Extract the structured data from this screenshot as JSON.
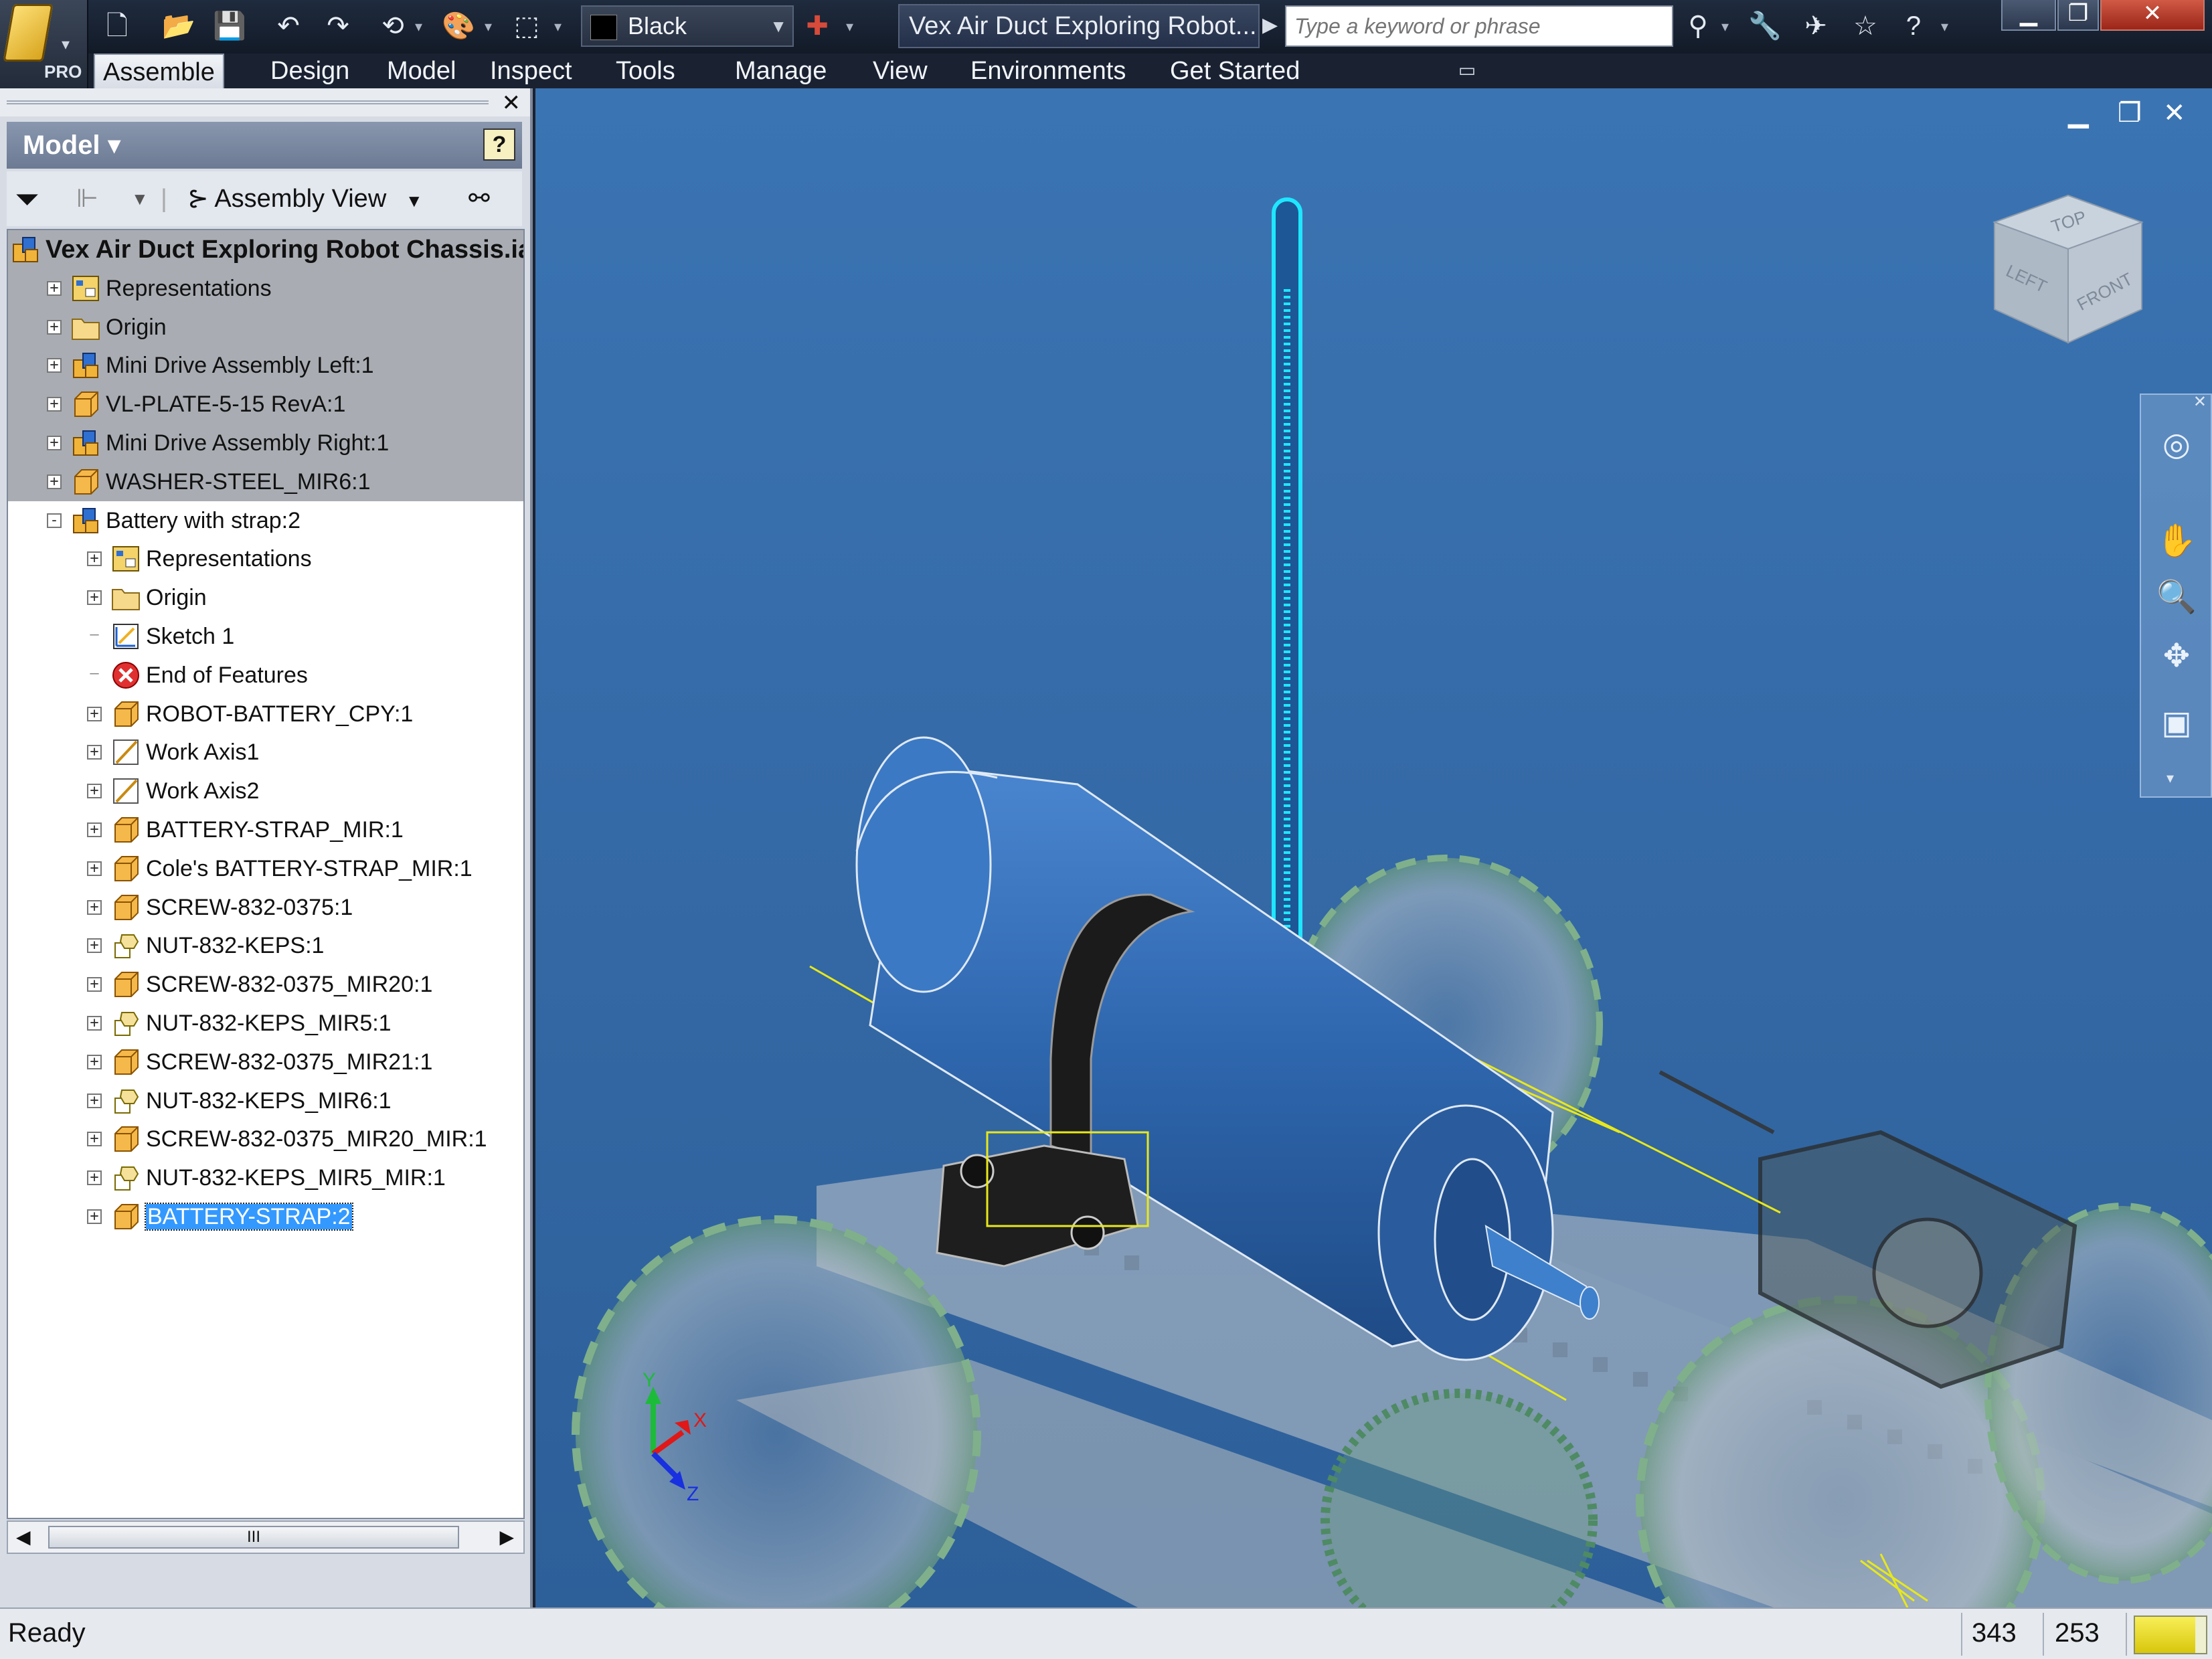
{
  "app": {
    "name": "Autodesk Inventor",
    "edition_badge": "PRO",
    "document_title": "Vex Air Duct Exploring Robot..."
  },
  "quick_access": {
    "icons": [
      "new-icon",
      "open-icon",
      "save-icon",
      "undo-icon",
      "redo-icon",
      "return-icon",
      "appearance-icon",
      "select-icon"
    ],
    "color_selector": {
      "value": "Black",
      "swatch": "#000000"
    }
  },
  "search": {
    "placeholder": "Type a keyword or phrase"
  },
  "help_icons": [
    "binoculars-icon",
    "wrench-icon",
    "satellite-icon",
    "star-icon",
    "help-icon"
  ],
  "ribbon": {
    "tabs": [
      "Assemble",
      "Design",
      "Model",
      "Inspect",
      "Tools",
      "Manage",
      "View",
      "Environments",
      "Get Started"
    ],
    "active_tab": "Assemble"
  },
  "browser": {
    "title": "Model",
    "view_label": "Assembly View",
    "help_glyph": "?",
    "tree": [
      {
        "label": "Vex Air Duct Exploring Robot Chassis.iam",
        "icon": "assembly",
        "level": 0,
        "expander": ""
      },
      {
        "label": "Representations",
        "icon": "representations",
        "level": 1,
        "expander": "+"
      },
      {
        "label": "Origin",
        "icon": "folder",
        "level": 1,
        "expander": "+"
      },
      {
        "label": "Mini Drive Assembly Left:1",
        "icon": "assembly",
        "level": 1,
        "expander": "+"
      },
      {
        "label": "VL-PLATE-5-15 RevA:1",
        "icon": "part",
        "level": 1,
        "expander": "+"
      },
      {
        "label": "Mini Drive Assembly Right:1",
        "icon": "assembly",
        "level": 1,
        "expander": "+"
      },
      {
        "label": "WASHER-STEEL_MIR6:1",
        "icon": "part",
        "level": 1,
        "expander": "+"
      },
      {
        "label": "Battery with strap:2",
        "icon": "assembly",
        "level": 1,
        "expander": "-"
      },
      {
        "label": "Representations",
        "icon": "representations",
        "level": 2,
        "expander": "+"
      },
      {
        "label": "Origin",
        "icon": "folder",
        "level": 2,
        "expander": "+"
      },
      {
        "label": "Sketch 1",
        "icon": "sketch",
        "level": 2,
        "expander": ""
      },
      {
        "label": "End of Features",
        "icon": "end",
        "level": 2,
        "expander": ""
      },
      {
        "label": "ROBOT-BATTERY_CPY:1",
        "icon": "part",
        "level": 2,
        "expander": "+"
      },
      {
        "label": "Work Axis1",
        "icon": "axis",
        "level": 2,
        "expander": "+"
      },
      {
        "label": "Work Axis2",
        "icon": "axis",
        "level": 2,
        "expander": "+"
      },
      {
        "label": "BATTERY-STRAP_MIR:1",
        "icon": "part",
        "level": 2,
        "expander": "+"
      },
      {
        "label": "Cole's BATTERY-STRAP_MIR:1",
        "icon": "part",
        "level": 2,
        "expander": "+"
      },
      {
        "label": "SCREW-832-0375:1",
        "icon": "part",
        "level": 2,
        "expander": "+"
      },
      {
        "label": "NUT-832-KEPS:1",
        "icon": "nut",
        "level": 2,
        "expander": "+"
      },
      {
        "label": "SCREW-832-0375_MIR20:1",
        "icon": "part",
        "level": 2,
        "expander": "+"
      },
      {
        "label": "NUT-832-KEPS_MIR5:1",
        "icon": "nut",
        "level": 2,
        "expander": "+"
      },
      {
        "label": "SCREW-832-0375_MIR21:1",
        "icon": "part",
        "level": 2,
        "expander": "+"
      },
      {
        "label": "NUT-832-KEPS_MIR6:1",
        "icon": "nut",
        "level": 2,
        "expander": "+"
      },
      {
        "label": "SCREW-832-0375_MIR20_MIR:1",
        "icon": "part",
        "level": 2,
        "expander": "+"
      },
      {
        "label": "NUT-832-KEPS_MIR5_MIR:1",
        "icon": "nut",
        "level": 2,
        "expander": "+"
      },
      {
        "label": "BATTERY-STRAP:2",
        "icon": "part",
        "level": 2,
        "expander": "+",
        "selected": true
      }
    ],
    "scrollbar_grip": "III"
  },
  "viewport": {
    "background": "#3468a6",
    "viewcube_faces": [
      "TOP",
      "LEFT",
      "FRONT"
    ],
    "triad_axes": [
      "Y",
      "X",
      "Z"
    ],
    "window_controls": [
      "minimize-icon",
      "restore-icon",
      "close-icon"
    ],
    "navbar_tools": [
      "steering-wheel-icon",
      "pan-icon",
      "zoom-icon",
      "orbit-icon",
      "look-at-icon"
    ]
  },
  "statusbar": {
    "status": "Ready",
    "x": "343",
    "y": "253",
    "memory_fraction": 0.85
  },
  "colors": {
    "battery": "#2f6fc0",
    "selection_cyan": "#1fe6ff",
    "highlight_yellow": "#e8e81a",
    "strap_black": "#1b1b1b"
  }
}
